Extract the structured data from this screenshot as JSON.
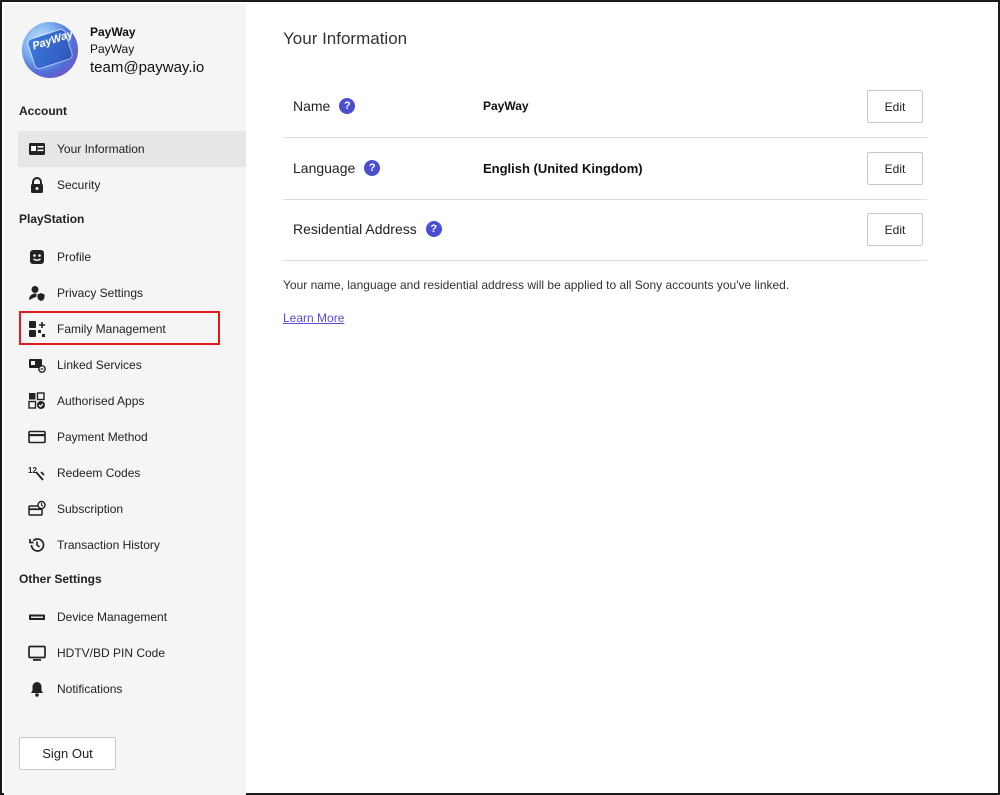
{
  "profile": {
    "avatar_text": "PayWay",
    "name": "PayWay",
    "online_id": "PayWay",
    "email": "team@payway.io"
  },
  "sidebar": {
    "sections": {
      "account": "Account",
      "playstation": "PlayStation",
      "other": "Other Settings"
    },
    "items": [
      {
        "label": "Your Information",
        "icon": "id-card-icon",
        "active": true
      },
      {
        "label": "Security",
        "icon": "lock-icon"
      },
      {
        "label": "Profile",
        "icon": "face-icon"
      },
      {
        "label": "Privacy Settings",
        "icon": "privacy-icon"
      },
      {
        "label": "Family Management",
        "icon": "family-icon"
      },
      {
        "label": "Linked Services",
        "icon": "linked-services-icon"
      },
      {
        "label": "Authorised Apps",
        "icon": "authorised-apps-icon"
      },
      {
        "label": "Payment Method",
        "icon": "credit-card-icon"
      },
      {
        "label": "Redeem Codes",
        "icon": "redeem-codes-icon"
      },
      {
        "label": "Subscription",
        "icon": "subscription-icon"
      },
      {
        "label": "Transaction History",
        "icon": "history-icon"
      },
      {
        "label": "Device Management",
        "icon": "console-icon"
      },
      {
        "label": "HDTV/BD PIN Code",
        "icon": "monitor-icon"
      },
      {
        "label": "Notifications",
        "icon": "bell-icon"
      }
    ],
    "sign_out": "Sign Out"
  },
  "main": {
    "title": "Your Information",
    "rows": [
      {
        "label": "Name",
        "value": "PayWay",
        "action": "Edit"
      },
      {
        "label": "Language",
        "value": "English (United Kingdom)",
        "action": "Edit"
      },
      {
        "label": "Residential Address",
        "value": "",
        "action": "Edit"
      }
    ],
    "info_text": "Your name, language and residential address will be applied to all Sony accounts you've linked.",
    "learn_more": "Learn More"
  },
  "colors": {
    "accent": "#4a4ed0",
    "link": "#5a4bd6",
    "highlight": "#e0191c",
    "sidebar_bg": "#f5f5f5"
  }
}
